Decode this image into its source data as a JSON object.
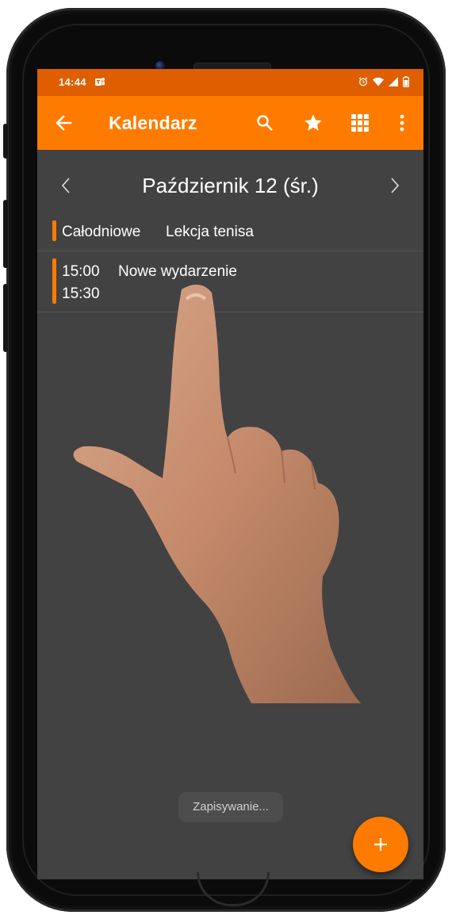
{
  "status_bar": {
    "time": "14:44",
    "icons": [
      "teams-icon",
      "alarm-icon",
      "wifi-icon",
      "signal-icon",
      "battery-icon"
    ],
    "color": "#de5e00"
  },
  "app_bar": {
    "title": "Kalendarz",
    "color": "#ff7b00",
    "actions": [
      "back-arrow-icon",
      "search-icon",
      "star-icon",
      "grid-icon",
      "more-vert-icon"
    ]
  },
  "date_nav": {
    "title": "Październik 12 (śr.)"
  },
  "all_day_event": {
    "label": "Całodniowe",
    "title": "Lekcja tenisa",
    "accent": "#ff7b00"
  },
  "event": {
    "start": "15:00",
    "end": "15:30",
    "title": "Nowe wydarzenie",
    "accent": "#ff7b00"
  },
  "toast": {
    "text": "Zapisywanie..."
  },
  "fab": {
    "icon": "plus-icon",
    "color": "#ff7b00"
  },
  "colors": {
    "background": "#424242",
    "divider": "#545454"
  }
}
